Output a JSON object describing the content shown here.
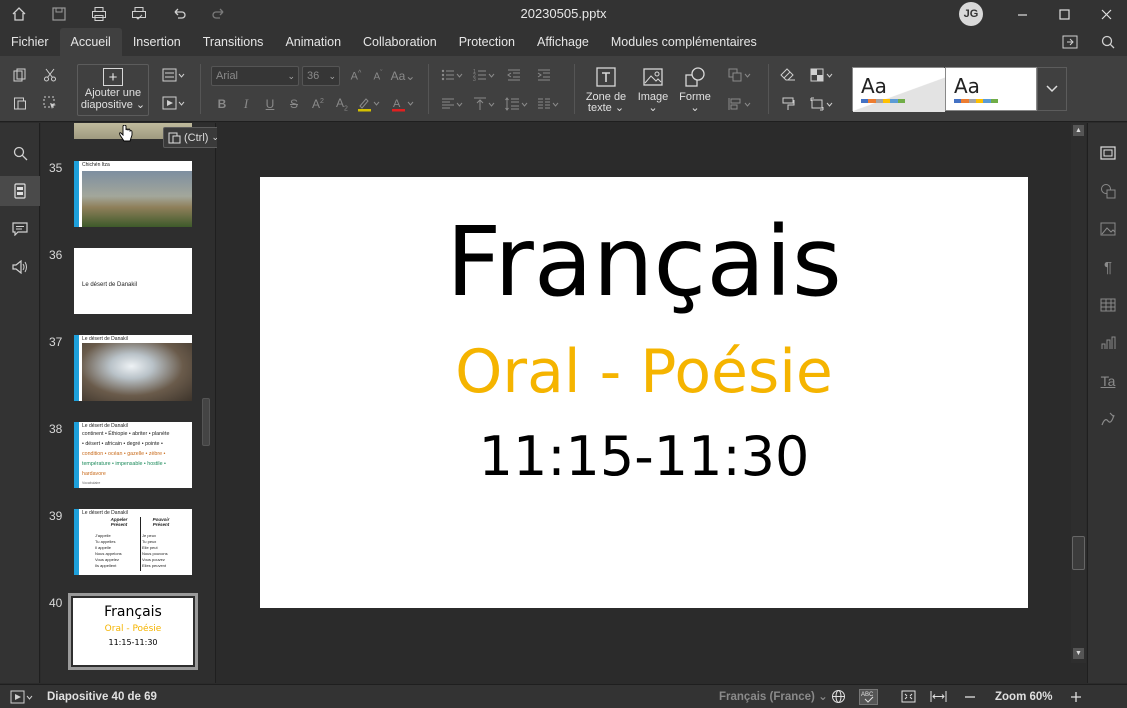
{
  "window": {
    "title": "20230505.pptx",
    "user_initials": "JG"
  },
  "menu": {
    "tabs": [
      "Fichier",
      "Accueil",
      "Insertion",
      "Transitions",
      "Animation",
      "Collaboration",
      "Protection",
      "Affichage",
      "Modules complémentaires"
    ],
    "active_tab": "Accueil"
  },
  "toolbar": {
    "add_slide_label_1": "Ajouter une",
    "add_slide_label_2": "diapositive",
    "font_name": "Arial",
    "font_size": "36",
    "text_box_label_1": "Zone de",
    "text_box_label_2": "texte",
    "image_label": "Image",
    "shape_label": "Forme",
    "theme_1_label": "Aa",
    "theme_2_label": "Aa",
    "theme_colors": [
      "#4472c4",
      "#ed7d31",
      "#a5a5a5",
      "#ffc000",
      "#5b9bd5",
      "#70ad47"
    ],
    "paste_tip": "(Ctrl)"
  },
  "thumbnails": [
    {
      "num": "35",
      "title": "Chichén Itza"
    },
    {
      "num": "36",
      "title": "Le désert de Danakil"
    },
    {
      "num": "37",
      "title": "Le désert de Danakil"
    },
    {
      "num": "38",
      "title": "Le désert de Danakil",
      "lines": [
        "continent • Éthiopie • abriter • planète",
        "• désert • africain • degré • pointe •",
        "condition • océan • gazelle • zèbre •",
        "température • impensable • hostile •",
        "hardavore"
      ],
      "footer": "Vocabulaire"
    },
    {
      "num": "39",
      "title": "Le désert de Danakil",
      "col1_head": "Appeler Présent",
      "col2_head": "Pouvoir Présent",
      "col1": [
        "J'appelle",
        "Tu appelles",
        "Il appelle",
        "Nous appelons",
        "Vous appelez",
        "Ils appellent"
      ],
      "col2": [
        "Je peux",
        "Tu peux",
        "Elle peut",
        "Nous pouvons",
        "Vous pouvez",
        "Elles peuvent"
      ]
    },
    {
      "num": "40",
      "title": "Français",
      "subtitle": "Oral - Poésie",
      "time": "11:15-11:30"
    }
  ],
  "slide": {
    "title": "Français",
    "subtitle": "Oral - Poésie",
    "time": "11:15-11:30"
  },
  "status": {
    "slide_position": "Diapositive 40 de 69",
    "language": "Français (France)",
    "zoom": "Zoom 60%"
  },
  "colors": {
    "accent_yellow": "#f5b400",
    "thumb_strip": "#1ea0db"
  }
}
